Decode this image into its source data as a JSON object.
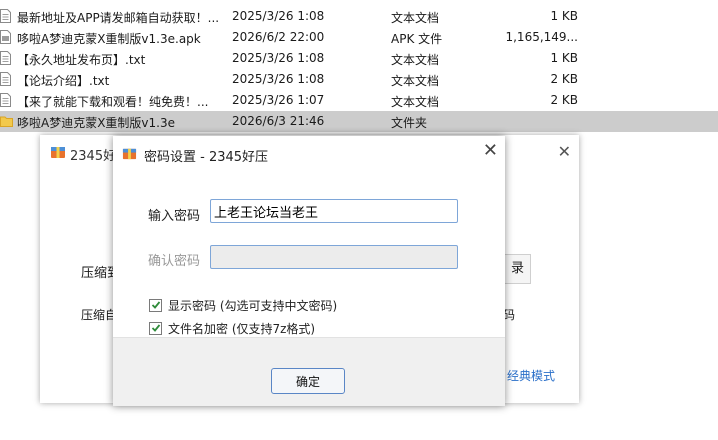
{
  "files": [
    {
      "name": "最新地址及APP请发邮箱自动获取！...",
      "date": "2025/3/26 1:08",
      "type": "文本文档",
      "size": "1 KB",
      "icon": "text-document-icon"
    },
    {
      "name": "哆啦A梦迪克蒙X重制版v1.3e.apk",
      "date": "2026/6/2 22:00",
      "type": "APK 文件",
      "size": "1,165,149...",
      "icon": "apk-file-icon"
    },
    {
      "name": "【永久地址发布页】.txt",
      "date": "2025/3/26 1:08",
      "type": "文本文档",
      "size": "1 KB",
      "icon": "text-document-icon"
    },
    {
      "name": "【论坛介绍】.txt",
      "date": "2025/3/26 1:08",
      "type": "文本文档",
      "size": "2 KB",
      "icon": "text-document-icon"
    },
    {
      "name": "【来了就能下载和观看！纯免费！...",
      "date": "2025/3/26 1:07",
      "type": "文本文档",
      "size": "2 KB",
      "icon": "text-document-icon"
    },
    {
      "name": "哆啦A梦迪克蒙X重制版v1.3e",
      "date": "2026/6/3 21:46",
      "type": "文件夹",
      "size": "",
      "icon": "folder-icon"
    }
  ],
  "back_window": {
    "title": "2345好",
    "label1": "压缩到",
    "label2": "压缩自",
    "button_fragment": "录",
    "right_fragment": "码",
    "classic_mode_link": "经典模式"
  },
  "dialog": {
    "title": "密码设置 - 2345好压",
    "password_label": "输入密码",
    "password_value": "上老王论坛当老王",
    "confirm_label": "确认密码",
    "confirm_value": "",
    "show_password_label": "显示密码 (勾选可支持中文密码)",
    "encrypt_names_label": "文件名加密  (仅支持7z格式)",
    "ok_label": "确定"
  },
  "colors": {
    "selection": "#cccccc",
    "input_border": "#7ea6d8",
    "ok_border": "#5a86c6",
    "link": "#2a6fc9",
    "checkbox_mark": "#2e8b3a"
  }
}
